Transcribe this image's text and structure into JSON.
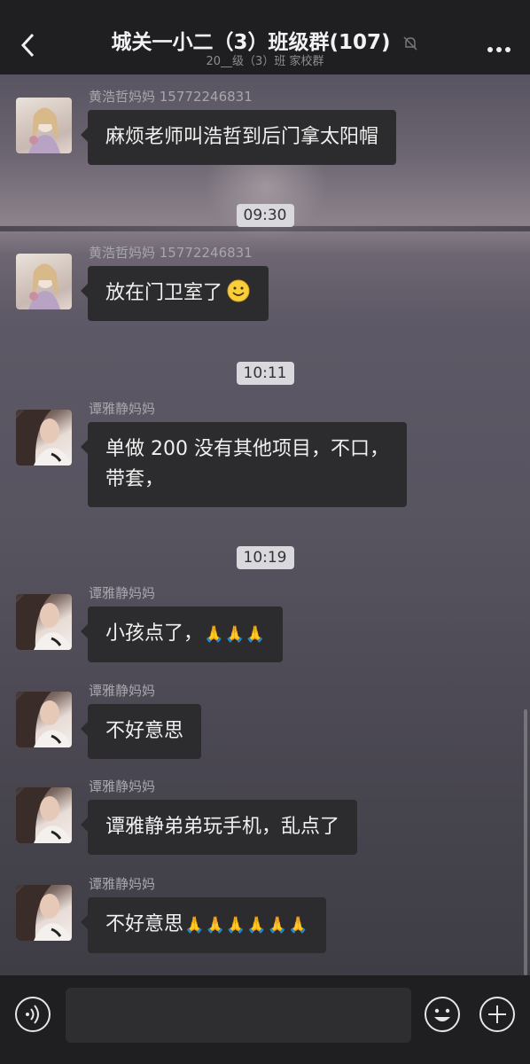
{
  "header": {
    "title": "城关一小二（3）班级群(107)",
    "subtitle": "20__级（3）班 家校群",
    "back_icon": "chevron-left-icon",
    "mute_icon": "bell-muted-icon",
    "more_icon": "more-dots-icon"
  },
  "timestamps": [
    "09:30",
    "10:11",
    "10:19"
  ],
  "messages": [
    {
      "sender": "黄浩哲妈妈 15772246831",
      "text": "麻烦老师叫浩哲到后门拿太阳帽",
      "avatar": "avatar-a"
    },
    {
      "sender": "黄浩哲妈妈 15772246831",
      "text": "放在门卫室了",
      "emoji": "smile-emoji",
      "avatar": "avatar-a"
    },
    {
      "sender": "谭雅静妈妈",
      "text_line1": "单做 200 没有其他项目，不口，",
      "text_line2": "带套，",
      "avatar": "avatar-b"
    },
    {
      "sender": "谭雅静妈妈",
      "text": "小孩点了，",
      "pray_count": 3,
      "avatar": "avatar-b"
    },
    {
      "sender": "谭雅静妈妈",
      "text": "不好意思",
      "avatar": "avatar-b"
    },
    {
      "sender": "谭雅静妈妈",
      "text": "谭雅静弟弟玩手机，乱点了",
      "avatar": "avatar-b"
    },
    {
      "sender": "谭雅静妈妈",
      "text": "不好意思",
      "pray_count": 6,
      "avatar": "avatar-b"
    }
  ],
  "pray_glyph": "🙏",
  "footer": {
    "voice_icon": "voice-icon",
    "emoji_icon": "emoji-icon",
    "plus_icon": "plus-icon",
    "input_value": ""
  }
}
